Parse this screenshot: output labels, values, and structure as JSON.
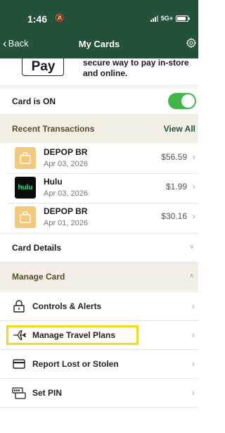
{
  "status_bar": {
    "time": "1:46",
    "network": "5G+"
  },
  "nav": {
    "back_label": "Back",
    "title": "My Cards"
  },
  "apple_pay": {
    "badge": "Pay",
    "text": "secure way to pay in-store and online."
  },
  "card_status": {
    "label": "Card is ON",
    "enabled": true
  },
  "recent": {
    "title": "Recent Transactions",
    "view_all": "View All",
    "items": [
      {
        "merchant": "DEPOP BR",
        "date": "Apr 03, 2026",
        "amount": "$56.59",
        "icon": "shopping-bag-icon"
      },
      {
        "merchant": "Hulu",
        "date": "Apr 03, 2026",
        "amount": "$1.99",
        "icon": "hulu-logo",
        "logo_text": "hulu"
      },
      {
        "merchant": "DEPOP BR",
        "date": "Apr 01, 2026",
        "amount": "$30.16",
        "icon": "shopping-bag-icon"
      }
    ]
  },
  "card_details": {
    "label": "Card Details"
  },
  "manage_card": {
    "label": "Manage Card",
    "items": [
      {
        "label": "Controls & Alerts",
        "icon": "lock-icon"
      },
      {
        "label": "Manage Travel Plans",
        "icon": "airplane-icon"
      },
      {
        "label": "Report Lost or Stolen",
        "icon": "card-icon"
      },
      {
        "label": "Set PIN",
        "icon": "pin-pad-icon"
      }
    ]
  },
  "colors": {
    "header": "#23513a",
    "toggle": "#42b44a",
    "highlight": "#f2dc1a",
    "section_bg": "#f3efe6"
  }
}
